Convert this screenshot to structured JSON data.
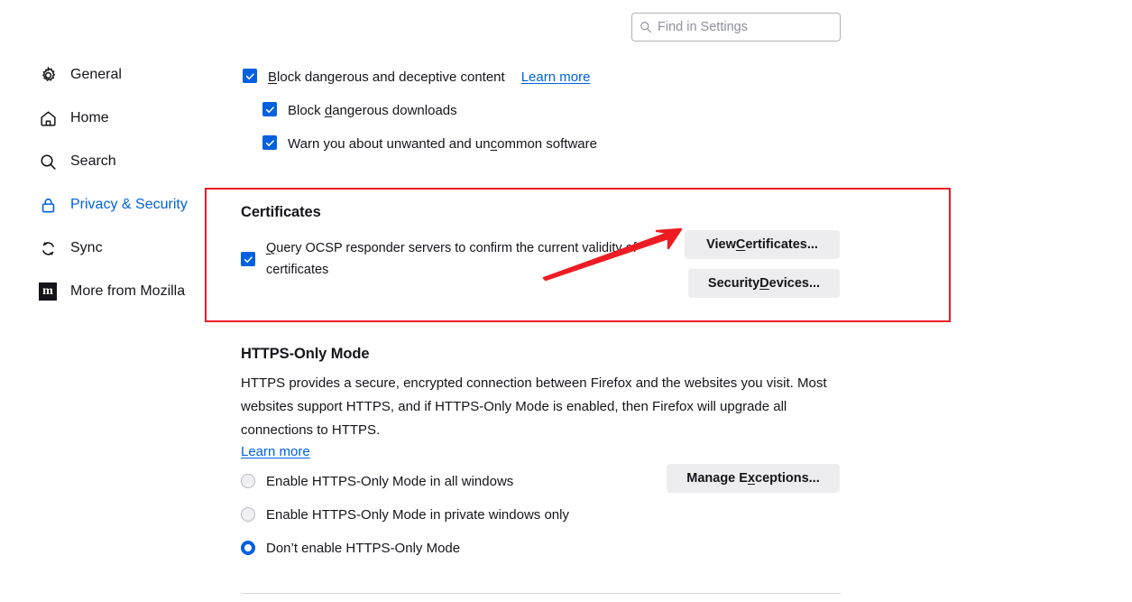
{
  "search": {
    "placeholder": "Find in Settings",
    "value": "",
    "icon": "search-icon"
  },
  "sidebar": {
    "items": [
      {
        "id": "general",
        "label": "General",
        "icon": "gear-icon",
        "selected": false
      },
      {
        "id": "home",
        "label": "Home",
        "icon": "home-icon",
        "selected": false
      },
      {
        "id": "search",
        "label": "Search",
        "icon": "search-icon",
        "selected": false
      },
      {
        "id": "privacy-security",
        "label": "Privacy & Security",
        "icon": "lock-icon",
        "selected": true
      },
      {
        "id": "sync",
        "label": "Sync",
        "icon": "sync-icon",
        "selected": false
      },
      {
        "id": "more-from-mozilla",
        "label": "More from Mozilla",
        "icon": "mozilla-m-icon",
        "selected": false
      }
    ],
    "selected_color": "#0060df",
    "mozilla_badge_letter": "m"
  },
  "deceptive_content": {
    "block_dangerous": {
      "label_prefix": "B",
      "label_rest": "lock dangerous and deceptive content",
      "checked": true,
      "learn_more": "Learn more"
    },
    "block_downloads": {
      "label_before": "Block ",
      "label_key": "d",
      "label_after": "angerous downloads",
      "checked": true
    },
    "warn_unwanted": {
      "label_before": "Warn you about unwanted and un",
      "label_key": "c",
      "label_after": "ommon software",
      "checked": true
    }
  },
  "certificates": {
    "title": "Certificates",
    "ocsp": {
      "label_key": "Q",
      "label_rest": "uery OCSP responder servers to confirm the current validity of certificates",
      "checked": true
    },
    "buttons": [
      {
        "id": "view-certificates",
        "before": "View ",
        "key": "C",
        "after": "ertificates..."
      },
      {
        "id": "security-devices",
        "before": "Security ",
        "key": "D",
        "after": "evices..."
      }
    ],
    "highlight_color": "#ed1c24"
  },
  "https_only": {
    "title": "HTTPS-Only Mode",
    "description": "HTTPS provides a secure, encrypted connection between Firefox and the websites you visit. Most websites support HTTPS, and if HTTPS-Only Mode is enabled, then Firefox will upgrade all connections to HTTPS.",
    "learn_more": "Learn more",
    "options": [
      {
        "id": "all-windows",
        "label": "Enable HTTPS-Only Mode in all windows",
        "selected": false
      },
      {
        "id": "private-windows",
        "label": "Enable HTTPS-Only Mode in private windows only",
        "selected": false
      },
      {
        "id": "disabled",
        "label": "Don’t enable HTTPS-Only Mode",
        "selected": true
      }
    ],
    "manage_exceptions": {
      "before": "Manage E",
      "key": "x",
      "after": "ceptions..."
    }
  },
  "annotation": {
    "type": "arrow",
    "color": "#ed1c24",
    "points_to": "view-certificates-button"
  }
}
